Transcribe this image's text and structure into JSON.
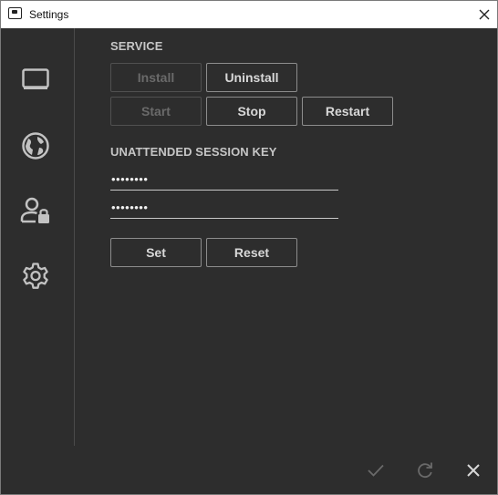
{
  "window": {
    "title": "Settings"
  },
  "sidebar": {
    "items": [
      {
        "name": "display",
        "icon": "monitor-icon"
      },
      {
        "name": "network",
        "icon": "globe-icon"
      },
      {
        "name": "security",
        "icon": "user-lock-icon"
      },
      {
        "name": "general",
        "icon": "gear-icon"
      }
    ]
  },
  "service": {
    "heading": "SERVICE",
    "install_label": "Install",
    "uninstall_label": "Uninstall",
    "start_label": "Start",
    "stop_label": "Stop",
    "restart_label": "Restart"
  },
  "session_key": {
    "heading": "UNATTENDED SESSION KEY",
    "password_value": "••••••••",
    "confirm_value": "••••••••",
    "set_label": "Set",
    "reset_label": "Reset"
  },
  "footer": {
    "icons": [
      "check-icon",
      "refresh-icon",
      "close-icon"
    ]
  },
  "colors": {
    "background": "#2d2d2d",
    "titlebar": "#ffffff",
    "text": "#d8d8d8",
    "disabled": "#6a6a6a",
    "icon": "#c2c2c2"
  }
}
